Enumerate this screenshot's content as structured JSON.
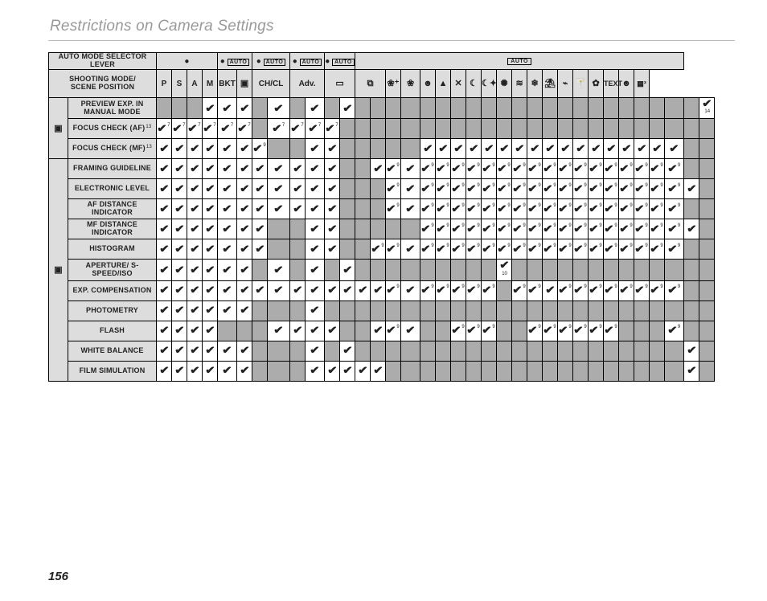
{
  "title": "Restrictions on Camera Settings",
  "page": "156",
  "hdr": {
    "auto_label": "Auto mode selector lever",
    "shoot_label": "Shooting mode/\nscene position",
    "dot": "●",
    "auto": "AUTO",
    "groups": [
      {
        "span": 4,
        "content": "dot"
      },
      {
        "span": 2,
        "content": "dot_auto"
      },
      {
        "span": 2,
        "content": "dot_auto"
      },
      {
        "span": 2,
        "content": "dot_auto"
      },
      {
        "span": 2,
        "content": "dot_auto"
      },
      {
        "span": 21,
        "content": "auto"
      }
    ],
    "cols": [
      {
        "t": "P",
        "b": true
      },
      {
        "t": "S",
        "b": true
      },
      {
        "t": "A",
        "b": true
      },
      {
        "t": "M",
        "b": true
      },
      {
        "t": "BKT",
        "b": true
      },
      {
        "i": "film-icon",
        "g": "▣"
      },
      {
        "t": "CH/CL",
        "b": true,
        "span": 2
      },
      {
        "t": "Adv.",
        "b": true,
        "span": 2
      },
      {
        "i": "pano-icon",
        "g": "▭",
        "span": 2
      },
      {
        "i": "multi-icon",
        "g": "⧉",
        "span": 2
      },
      {
        "i": "natural-icon",
        "g": "❀⁺"
      },
      {
        "i": "natural2-icon",
        "g": "❀"
      },
      {
        "i": "portrait-icon",
        "g": "☻"
      },
      {
        "i": "landscape-icon",
        "g": "▲"
      },
      {
        "i": "sport-icon",
        "g": "✕"
      },
      {
        "i": "night-icon",
        "g": "☾"
      },
      {
        "i": "night2-icon",
        "g": "☾✦"
      },
      {
        "i": "fireworks-icon",
        "g": "✺"
      },
      {
        "i": "sunset-icon",
        "g": "≋"
      },
      {
        "i": "snow-icon",
        "g": "❄"
      },
      {
        "i": "beach-icon",
        "g": "⛱"
      },
      {
        "i": "underwater-icon",
        "g": "⌁"
      },
      {
        "i": "party-icon",
        "g": "🍸"
      },
      {
        "i": "flower-icon",
        "g": "✿"
      },
      {
        "i": "text-icon",
        "g": "TEXT",
        "s": true
      },
      {
        "i": "face-icon",
        "g": "☻"
      },
      {
        "i": "group-icon",
        "g": "▦³",
        "s": true
      }
    ]
  },
  "sections": [
    {
      "icon": "viewfinder-icon",
      "glyph": "▣",
      "rows": [
        {
          "label": "PREVIEW EXP. IN MANUAL MODE",
          "cells": [
            "g",
            "g",
            "g",
            "c",
            "c",
            "c",
            "g",
            "c",
            "g",
            "c",
            "g",
            "c",
            "g",
            "g",
            "g",
            "g",
            "g",
            "g",
            "g",
            "g",
            "g",
            "g",
            "g",
            "g",
            "g",
            "g",
            "g",
            "g",
            "g",
            "g",
            "g",
            "g",
            "g",
            "g",
            "c14"
          ]
        },
        {
          "label": "FOCUS CHECK (AF)",
          "fn": "13",
          "cells": [
            "c7",
            "c7",
            "c7",
            "c7",
            "c7",
            "c7",
            "g",
            "c7",
            "c7",
            "c7",
            "c7",
            "g",
            "g",
            "g",
            "g",
            "g",
            "g",
            "g",
            "g",
            "g",
            "g",
            "g",
            "g",
            "g",
            "g",
            "g",
            "g",
            "g",
            "g",
            "g",
            "g",
            "g",
            "g",
            "g",
            "g"
          ]
        },
        {
          "label": "FOCUS CHECK (MF)",
          "fn": "13",
          "cells": [
            "c",
            "c",
            "c",
            "c",
            "c",
            "c",
            "c9",
            "g",
            "g",
            "c",
            "c",
            "g",
            "g",
            "g",
            "g",
            "g",
            "c",
            "c",
            "c",
            "c",
            "c",
            "c",
            "c",
            "c",
            "c",
            "c",
            "c",
            "c",
            "c",
            "c",
            "c",
            "c",
            "c",
            "g",
            "g"
          ]
        }
      ]
    },
    {
      "icon": "display-icon",
      "glyph": "▣",
      "rows": [
        {
          "label": "FRAMING GUIDELINE",
          "cells": [
            "c",
            "c",
            "c",
            "c",
            "c",
            "c",
            "c",
            "c",
            "c",
            "c",
            "c",
            "g",
            "g",
            "c",
            "c9",
            "c",
            "c9",
            "c9",
            "c9",
            "c9",
            "c9",
            "c9",
            "c9",
            "c9",
            "c9",
            "c9",
            "c9",
            "c9",
            "c9",
            "c9",
            "c9",
            "c9",
            "c9",
            "g",
            "g"
          ]
        },
        {
          "label": "ELECTRONIC LEVEL",
          "cells": [
            "c",
            "c",
            "c",
            "c",
            "c",
            "c",
            "c",
            "c",
            "c",
            "c",
            "c",
            "g",
            "g",
            "g",
            "c9",
            "c",
            "c9",
            "c9",
            "c9",
            "c9",
            "c9",
            "c9",
            "c9",
            "c9",
            "c9",
            "c9",
            "c9",
            "c9",
            "c9",
            "c9",
            "c9",
            "c9",
            "c9",
            "c",
            "g"
          ]
        },
        {
          "label": "AF DISTANCE INDICATOR",
          "cells": [
            "c",
            "c",
            "c",
            "c",
            "c",
            "c",
            "c",
            "c",
            "c",
            "c",
            "c",
            "g",
            "g",
            "g",
            "c9",
            "c",
            "c9",
            "c9",
            "c9",
            "c9",
            "c9",
            "c9",
            "c9",
            "c9",
            "c9",
            "c9",
            "c9",
            "c9",
            "c9",
            "c9",
            "c9",
            "c9",
            "c9",
            "g",
            "g"
          ]
        },
        {
          "label": "MF DISTANCE INDICATOR",
          "cells": [
            "c",
            "c",
            "c",
            "c",
            "c",
            "c",
            "c",
            "g",
            "g",
            "c",
            "c",
            "g",
            "g",
            "g",
            "g",
            "g",
            "c9",
            "c9",
            "c9",
            "c9",
            "c9",
            "c9",
            "c9",
            "c9",
            "c9",
            "c9",
            "c9",
            "c9",
            "c9",
            "c9",
            "c9",
            "c9",
            "c9",
            "c",
            "g"
          ]
        },
        {
          "label": "HISTOGRAM",
          "cells": [
            "c",
            "c",
            "c",
            "c",
            "c",
            "c",
            "c",
            "g",
            "g",
            "c",
            "c",
            "g",
            "g",
            "c9",
            "c9",
            "c",
            "c9",
            "c9",
            "c9",
            "c9",
            "c9",
            "c9",
            "c9",
            "c9",
            "c9",
            "c9",
            "c9",
            "c9",
            "c9",
            "c9",
            "c9",
            "c9",
            "c9",
            "g",
            "g"
          ]
        },
        {
          "label": "APERTURE/ S-SPEED/ISO",
          "cells": [
            "c",
            "c",
            "c",
            "c",
            "c",
            "c",
            "g",
            "c",
            "g",
            "c",
            "g",
            "c",
            "g",
            "g",
            "g",
            "g",
            "g",
            "g",
            "g",
            "g",
            "g",
            "c10",
            "g",
            "g",
            "g",
            "g",
            "g",
            "g",
            "g",
            "g",
            "g",
            "g",
            "g",
            "g",
            "g"
          ]
        },
        {
          "label": "EXP. COMPENSATION",
          "cells": [
            "c",
            "c",
            "c",
            "c",
            "c",
            "c",
            "c",
            "c",
            "c",
            "c",
            "c",
            "c",
            "c",
            "c",
            "c9",
            "c",
            "c9",
            "c9",
            "c9",
            "c9",
            "c9",
            "g",
            "c9",
            "c9",
            "c",
            "c9",
            "c9",
            "c9",
            "c9",
            "c9",
            "c9",
            "c9",
            "c9",
            "g",
            "g"
          ]
        },
        {
          "label": "PHOTOMETRY",
          "cells": [
            "c",
            "c",
            "c",
            "c",
            "c",
            "c",
            "g",
            "g",
            "g",
            "c",
            "g",
            "g",
            "g",
            "g",
            "g",
            "g",
            "g",
            "g",
            "g",
            "g",
            "g",
            "g",
            "g",
            "g",
            "g",
            "g",
            "g",
            "g",
            "g",
            "g",
            "g",
            "g",
            "g",
            "g",
            "g"
          ]
        },
        {
          "label": "FLASH",
          "cells": [
            "c",
            "c",
            "c",
            "c",
            "g",
            "g",
            "g",
            "c",
            "c",
            "c",
            "c",
            "g",
            "g",
            "c",
            "c9",
            "c",
            "g",
            "g",
            "c9",
            "c9",
            "c9",
            "g",
            "g",
            "c9",
            "c9",
            "c9",
            "c9",
            "c9",
            "c9",
            "g",
            "g",
            "g",
            "c9",
            "g",
            "g"
          ]
        },
        {
          "label": "WHITE BALANCE",
          "cells": [
            "c",
            "c",
            "c",
            "c",
            "c",
            "c",
            "g",
            "g",
            "g",
            "c",
            "g",
            "c",
            "g",
            "g",
            "g",
            "g",
            "g",
            "g",
            "g",
            "g",
            "g",
            "g",
            "g",
            "g",
            "g",
            "g",
            "g",
            "g",
            "g",
            "g",
            "g",
            "g",
            "g",
            "c",
            "g"
          ]
        },
        {
          "label": "FILM SIMULATION",
          "cells": [
            "c",
            "c",
            "c",
            "c",
            "c",
            "c",
            "g",
            "g",
            "g",
            "c",
            "c",
            "c",
            "c",
            "c",
            "g",
            "g",
            "g",
            "g",
            "g",
            "g",
            "g",
            "g",
            "g",
            "g",
            "g",
            "g",
            "g",
            "g",
            "g",
            "g",
            "g",
            "g",
            "g",
            "c",
            "g"
          ]
        }
      ]
    }
  ]
}
